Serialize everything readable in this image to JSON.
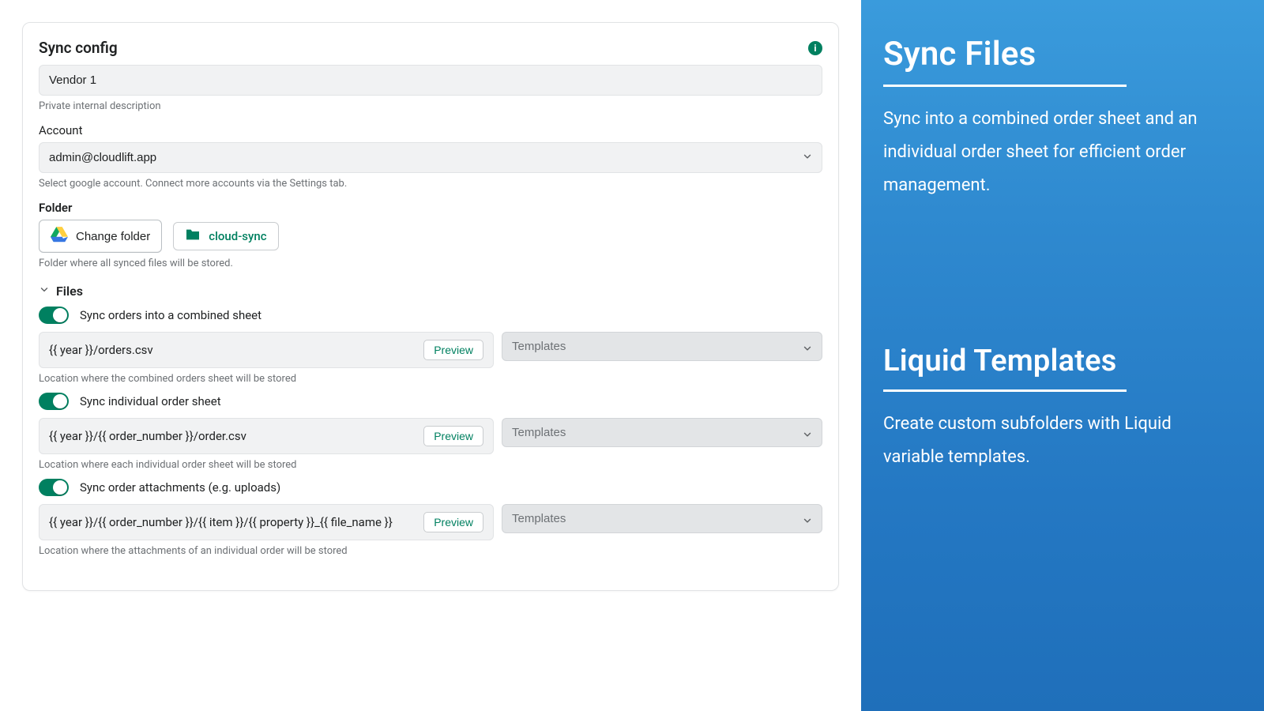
{
  "card": {
    "title": "Sync config",
    "vendor_value": "Vendor 1",
    "vendor_help": "Private internal description",
    "account_label": "Account",
    "account_value": "admin@cloudlift.app",
    "account_help": "Select google account. Connect more accounts via the Settings tab.",
    "folder_label": "Folder",
    "change_folder_btn": "Change folder",
    "folder_badge": "cloud-sync",
    "folder_help": "Folder where all synced files will be stored.",
    "files_section": "Files"
  },
  "files": [
    {
      "toggle_label": "Sync orders into a combined sheet",
      "path": "{{ year }}/orders.csv",
      "preview": "Preview",
      "templates": "Templates",
      "help": "Location where the combined orders sheet will be stored"
    },
    {
      "toggle_label": "Sync individual order sheet",
      "path": "{{ year }}/{{ order_number }}/order.csv",
      "preview": "Preview",
      "templates": "Templates",
      "help": "Location where each individual order sheet will be stored"
    },
    {
      "toggle_label": "Sync order attachments (e.g. uploads)",
      "path": "{{ year }}/{{ order_number }}/{{ item }}/{{ property }}_{{ file_name }}",
      "preview": "Preview",
      "templates": "Templates",
      "help": "Location where the attachments of an individual order will be stored"
    }
  ],
  "sidebar": {
    "h1": "Sync Files",
    "p1": "Sync into a combined order sheet and an individual order sheet for efficient order management.",
    "h2": "Liquid Templates",
    "p2": "Create custom subfolders with Liquid variable templates."
  }
}
